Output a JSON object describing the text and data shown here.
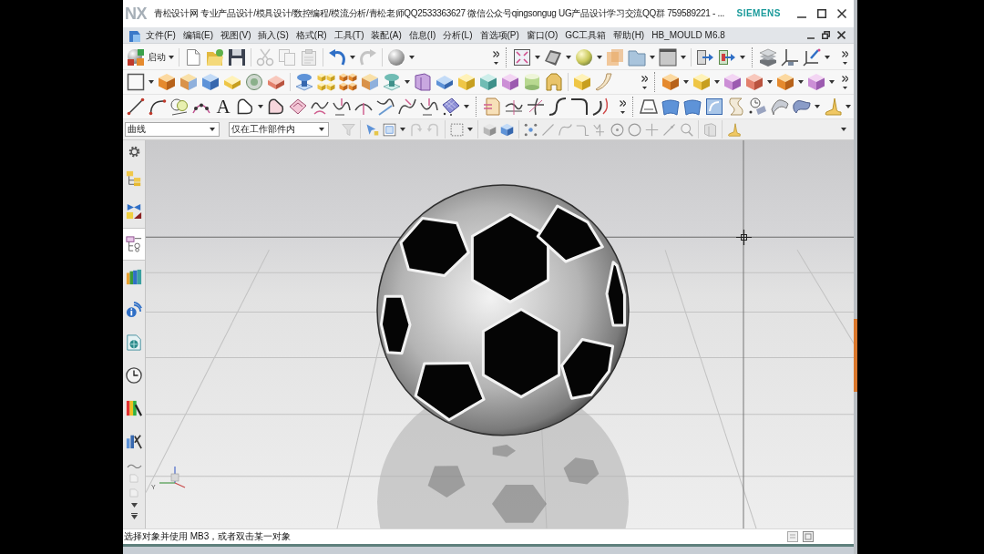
{
  "title_bar": {
    "logo": "NX",
    "title": "青松设计网 专业产品设计/模具设计/数控编程/模流分析/青松老师QQ2533363627 微信公众号qingsongug UG产品设计学习交流QQ群 759589221 - ...",
    "brand": "SIEMENS"
  },
  "menu_bar": {
    "items": [
      "文件(F)",
      "编辑(E)",
      "视图(V)",
      "插入(S)",
      "格式(R)",
      "工具(T)",
      "装配(A)",
      "信息(I)",
      "分析(L)",
      "首选项(P)",
      "窗口(O)",
      "GC工具箱",
      "帮助(H)",
      "HB_MOULD M6.8"
    ]
  },
  "toolbar": {
    "start_label": "启动",
    "text_tool_glyph": "A"
  },
  "selection_bar": {
    "type_filter": "曲线",
    "scope_filter": "仅在工作部件内"
  },
  "resource_bar": {
    "items": [
      {
        "kind": "tree",
        "selected": false
      },
      {
        "kind": "bowtie",
        "selected": false
      },
      {
        "kind": "links",
        "selected": true
      },
      {
        "kind": "books",
        "selected": false
      },
      {
        "kind": "signal",
        "selected": false
      },
      {
        "kind": "webpage",
        "selected": false
      },
      {
        "kind": "clock",
        "selected": false
      },
      {
        "kind": "spectrum",
        "selected": false
      },
      {
        "kind": "chart",
        "selected": false
      }
    ]
  },
  "viewport": {
    "axis_label": "Y"
  },
  "status_bar": {
    "prompt": "选择对象并使用 MB3，或者双击某一对象"
  }
}
